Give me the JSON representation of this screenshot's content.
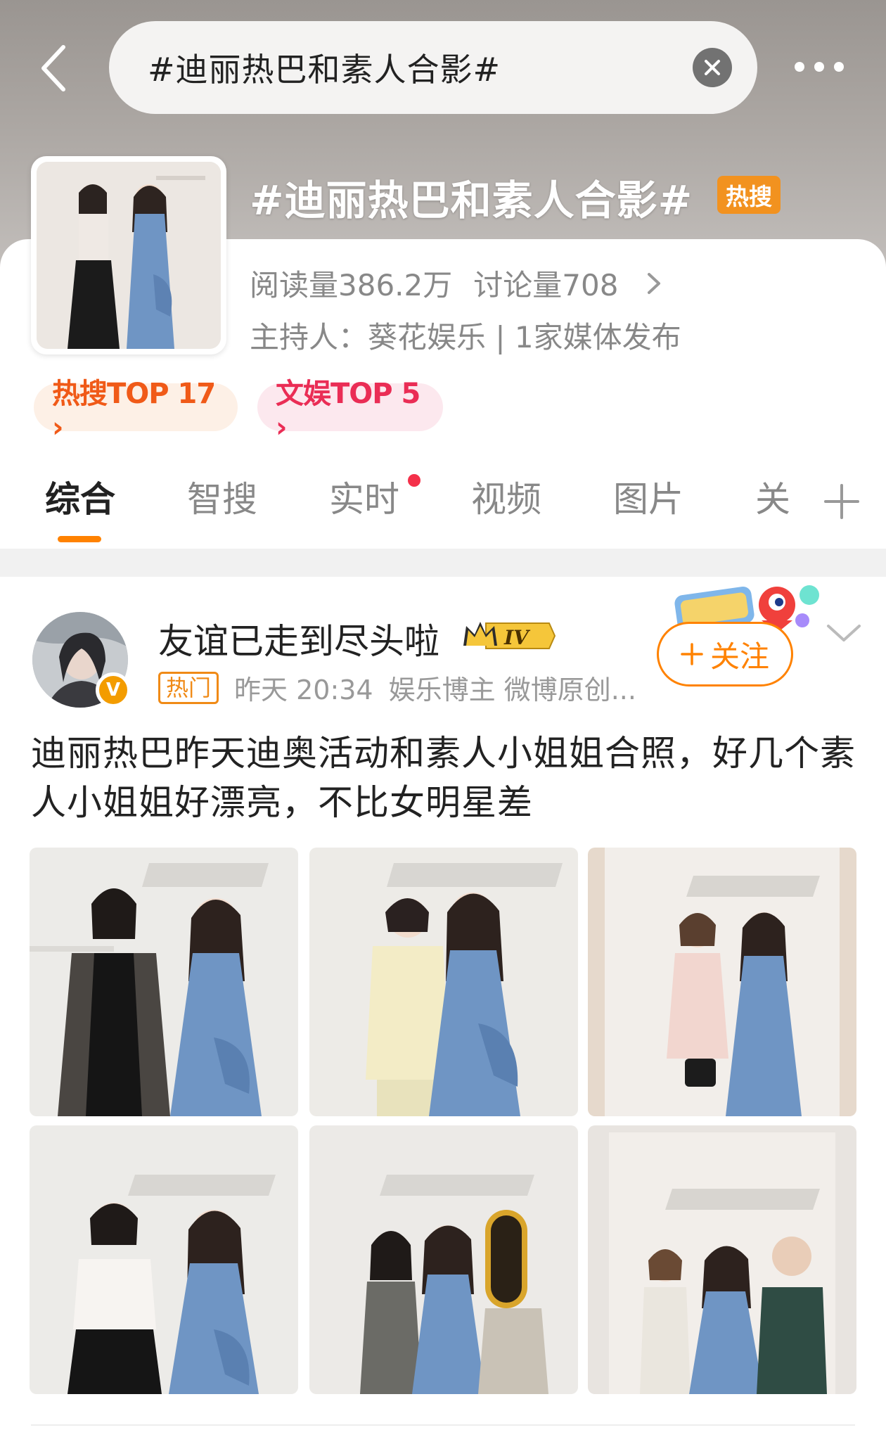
{
  "search": {
    "query": "#迪丽热巴和素人合影#"
  },
  "topic": {
    "title": "#迪丽热巴和素人合影#",
    "badge": "热搜",
    "reads": "阅读量386.2万",
    "discussions": "讨论量708",
    "host": "主持人：葵花娱乐 | 1家媒体发布"
  },
  "rankings": [
    {
      "label": "热搜TOP 17 ›"
    },
    {
      "label": "文娱TOP 5 ›"
    }
  ],
  "tabs": [
    {
      "label": "综合"
    },
    {
      "label": "智搜"
    },
    {
      "label": "实时"
    },
    {
      "label": "视频"
    },
    {
      "label": "图片"
    },
    {
      "label": "关"
    }
  ],
  "post": {
    "username": "友谊已走到尽头啦",
    "level": "IV",
    "hot_tag": "热门",
    "time": "昨天 20:34",
    "meta": "娱乐博主 微博原创...",
    "follow_label": "关注",
    "text": "迪丽热巴昨天迪奥活动和素人小姐姐合照，好几个素人小姐姐好漂亮，不比女明星差"
  },
  "colors": {
    "accent": "#ff8200",
    "hot_badge": "#f2921f",
    "rank_hot": "#f05a18",
    "rank_ent": "#ea2d55",
    "dress_blue": "#6f95c4"
  }
}
